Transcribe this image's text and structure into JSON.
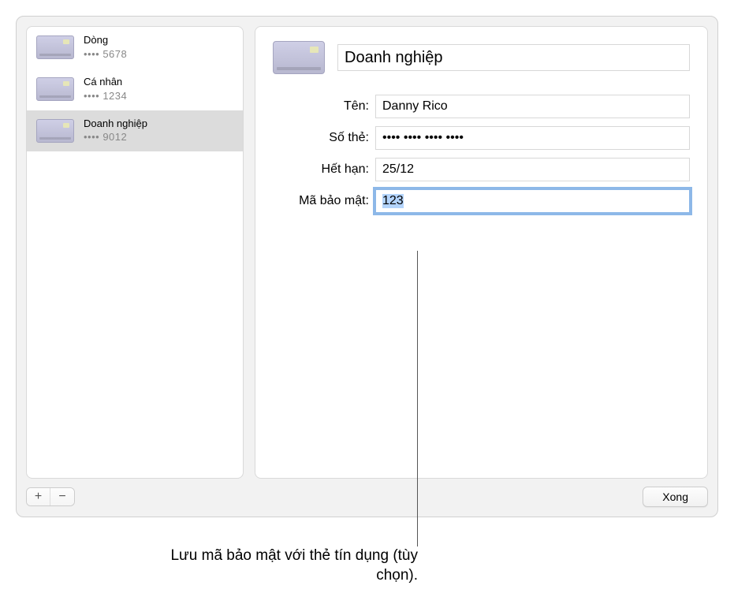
{
  "sidebar": {
    "cards": [
      {
        "name": "Dòng",
        "number": "•••• 5678"
      },
      {
        "name": "Cá nhân",
        "number": "•••• 1234"
      },
      {
        "name": "Doanh nghiệp",
        "number": "•••• 9012"
      }
    ]
  },
  "detail": {
    "title": "Doanh nghiệp",
    "fields": {
      "name_label": "Tên:",
      "name_value": "Danny Rico",
      "number_label": "Số thẻ:",
      "number_value": "•••• •••• •••• ••••",
      "expiry_label": "Hết hạn:",
      "expiry_value": "25/12",
      "security_label": "Mã bảo mật:",
      "security_value": "123"
    }
  },
  "buttons": {
    "add": "+",
    "remove": "−",
    "done": "Xong"
  },
  "callout": {
    "text": "Lưu mã bảo mật với thẻ tín dụng (tùy chọn)."
  }
}
